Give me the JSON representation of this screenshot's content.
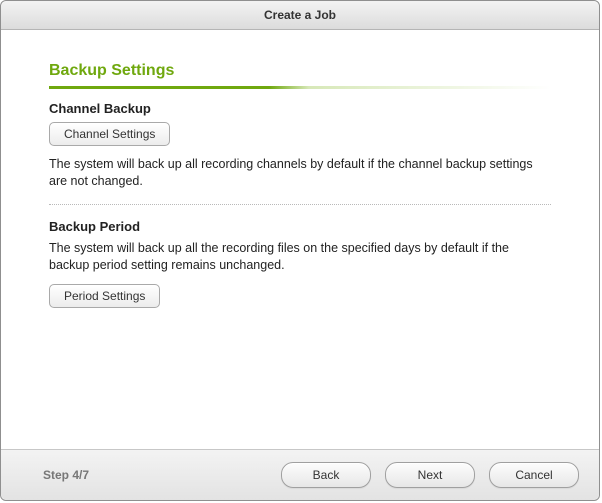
{
  "window": {
    "title": "Create a Job"
  },
  "page": {
    "heading": "Backup Settings"
  },
  "channel": {
    "title": "Channel Backup",
    "button": "Channel Settings",
    "description": "The system will back up all recording channels by default if the channel backup settings are not changed."
  },
  "period": {
    "title": "Backup Period",
    "description": "The system will back up all the recording files on the specified days by default if the backup period setting remains unchanged.",
    "button": "Period Settings"
  },
  "footer": {
    "step": "Step 4/7",
    "back": "Back",
    "next": "Next",
    "cancel": "Cancel"
  }
}
